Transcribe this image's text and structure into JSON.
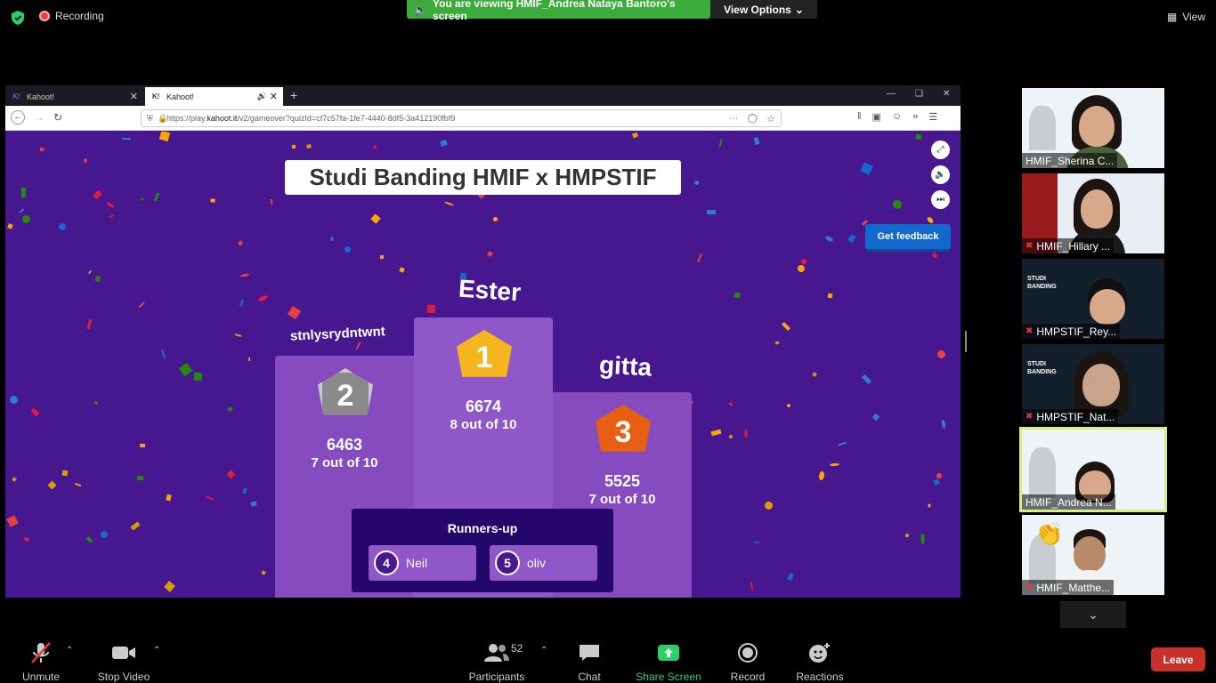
{
  "topbar": {
    "recording_label": "Recording",
    "viewing_text": "You are viewing HMIF_Andrea Nataya Bantoro's screen",
    "view_options_label": "View Options",
    "view_label": "View"
  },
  "browser": {
    "tabs": [
      {
        "label": "Kahoot!"
      },
      {
        "label": "Kahoot!"
      }
    ],
    "url_prefix": "https://play.",
    "url_domain": "kahoot.it",
    "url_rest": "/v2/gameover?quizId=cf7c57fa-1fe7-4440-8df5-3a412190fbf9"
  },
  "kahoot": {
    "title": "Studi Banding HMIF x HMPSTIF",
    "feedback_label": "Get feedback",
    "podium": [
      {
        "rank": "1",
        "name": "Ester",
        "score": "6674",
        "correct": "8 out of 10"
      },
      {
        "rank": "2",
        "name": "stnlysrydntwnt",
        "score": "6463",
        "correct": "7 out of 10"
      },
      {
        "rank": "3",
        "name": "gitta",
        "score": "5525",
        "correct": "7 out of 10"
      }
    ],
    "runners_header": "Runners-up",
    "runners": [
      {
        "rank": "4",
        "name": "Neil"
      },
      {
        "rank": "5",
        "name": "oliv"
      }
    ]
  },
  "participants_gallery": [
    {
      "name": "HMIF_Sherina C..."
    },
    {
      "name": "HMIF_Hillary ..."
    },
    {
      "name": "HMPSTIF_Rey..."
    },
    {
      "name": "HMPSTIF_Nat..."
    },
    {
      "name": "HMIF_Andrea N..."
    },
    {
      "name": "HMIF_Matthe..."
    }
  ],
  "toolbar": {
    "unmute": "Unmute",
    "stop_video": "Stop Video",
    "participants": "Participants",
    "participants_count": "52",
    "chat": "Chat",
    "share_screen": "Share Screen",
    "record": "Record",
    "reactions": "Reactions",
    "leave": "Leave"
  },
  "colors": {
    "kahoot_bg": "#46178f",
    "viewing_banner": "#3bab3b",
    "share_green": "#2ad06a",
    "leave_red": "#c8312a",
    "feedback_blue": "#1368ce",
    "gold": "#f5b51c",
    "silver": "#8a8a8a",
    "bronze": "#e85f14"
  }
}
